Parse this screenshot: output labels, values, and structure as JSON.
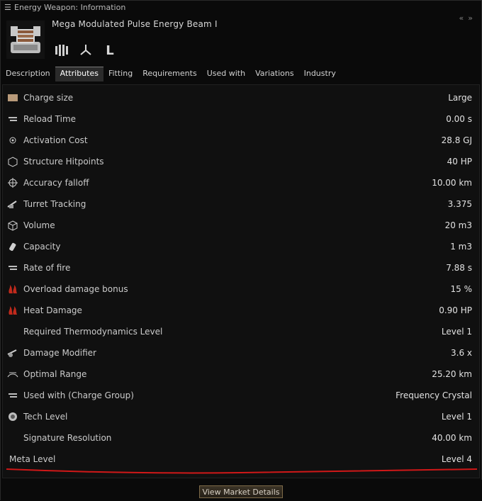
{
  "window": {
    "title": "Energy Weapon: Information",
    "item_name": "Mega Modulated Pulse Energy Beam I",
    "size_letter": "L",
    "collapse_icon": "double-chevron-left",
    "expand_icon": "double-chevron-right"
  },
  "tabs": [
    {
      "label": "Description",
      "active": false
    },
    {
      "label": "Attributes",
      "active": true
    },
    {
      "label": "Fitting",
      "active": false
    },
    {
      "label": "Requirements",
      "active": false
    },
    {
      "label": "Used with",
      "active": false
    },
    {
      "label": "Variations",
      "active": false
    },
    {
      "label": "Industry",
      "active": false
    }
  ],
  "attributes": [
    {
      "label": "Charge size",
      "value": "Large",
      "icon": "charge-size-icon"
    },
    {
      "label": "Reload Time",
      "value": "0.00 s",
      "icon": "reload-time-icon"
    },
    {
      "label": "Activation Cost",
      "value": "28.8 GJ",
      "icon": "activation-cost-icon"
    },
    {
      "label": "Structure Hitpoints",
      "value": "40 HP",
      "icon": "structure-hp-icon"
    },
    {
      "label": "Accuracy falloff",
      "value": "10.00 km",
      "icon": "crosshair-icon"
    },
    {
      "label": "Turret Tracking",
      "value": "3.375",
      "icon": "turret-tracking-icon"
    },
    {
      "label": "Volume",
      "value": "20 m3",
      "icon": "cube-icon"
    },
    {
      "label": "Capacity",
      "value": "1 m3",
      "icon": "capacity-icon"
    },
    {
      "label": "Rate of fire",
      "value": "7.88 s",
      "icon": "rate-of-fire-icon"
    },
    {
      "label": "Overload damage bonus",
      "value": "15 %",
      "icon": "heat-icon"
    },
    {
      "label": "Heat Damage",
      "value": "0.90 HP",
      "icon": "heat-icon"
    },
    {
      "label": "Required Thermodynamics Level",
      "value": "Level 1",
      "icon": ""
    },
    {
      "label": "Damage Modifier",
      "value": "3.6 x",
      "icon": "damage-modifier-icon"
    },
    {
      "label": "Optimal Range",
      "value": "25.20 km",
      "icon": "optimal-range-icon"
    },
    {
      "label": "Used with (Charge Group)",
      "value": "Frequency Crystal",
      "icon": "charge-group-icon"
    },
    {
      "label": "Tech Level",
      "value": "Level 1",
      "icon": "tech-level-icon"
    },
    {
      "label": "Signature Resolution",
      "value": "40.00 km",
      "icon": ""
    },
    {
      "label": "Meta Level",
      "value": "Level 4",
      "icon": ""
    }
  ],
  "footer": {
    "market_button": "View Market Details"
  },
  "colors": {
    "highlight_underline": "#d01818",
    "tab_active_bg": "#2b2b2b",
    "button_border": "#7d6a48"
  }
}
